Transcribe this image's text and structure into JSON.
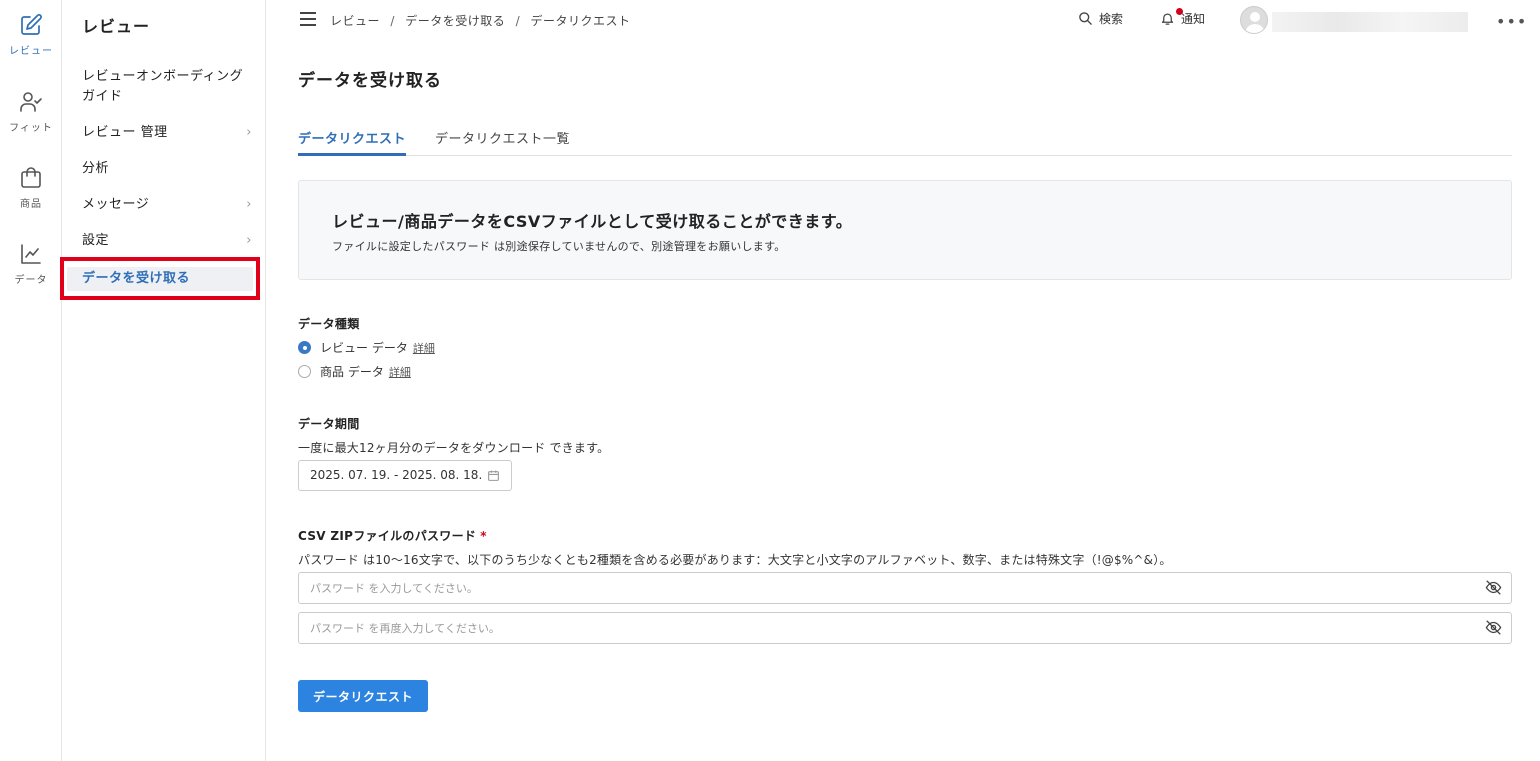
{
  "rail": {
    "items": [
      {
        "label": "レビュー",
        "icon": "edit-icon",
        "active": true
      },
      {
        "label": "フィット",
        "icon": "user-check-icon"
      },
      {
        "label": "商品",
        "icon": "shopping-bag-icon"
      },
      {
        "label": "データ",
        "icon": "line-chart-icon"
      }
    ]
  },
  "subnav": {
    "title": "レビュー",
    "items": [
      {
        "label_line1": "レビューオンボーディング",
        "label_line2": "ガイド"
      },
      {
        "label": "レビュー 管理",
        "chevron": "›"
      },
      {
        "label": "分析"
      },
      {
        "label": "メッセージ",
        "chevron": "›"
      },
      {
        "label": "設定",
        "chevron": "›"
      },
      {
        "label": "データを受け取る",
        "active": true
      }
    ]
  },
  "topbar": {
    "breadcrumb": [
      "レビュー",
      "データを受け取る",
      "データリクエスト"
    ],
    "breadcrumb_sep": "/",
    "search_label": "検索",
    "notification_label": "通知",
    "more": "•••"
  },
  "main": {
    "page_title": "データを受け取る",
    "tabs": [
      {
        "label": "データリクエスト",
        "active": true
      },
      {
        "label": "データリクエスト一覧"
      }
    ],
    "info": {
      "heading": "レビュー/商品データをCSVファイルとして受け取ることができます。",
      "sub": "ファイルに設定したパスワード は別途保存していませんので、別途管理をお願いします。"
    },
    "data_type": {
      "label": "データ種類",
      "options": [
        {
          "label": "レビュー データ",
          "link": "詳細",
          "checked": true
        },
        {
          "label": "商品 データ",
          "link": "詳細",
          "checked": false
        }
      ]
    },
    "period": {
      "label": "データ期間",
      "desc": "一度に最大12ヶ月分のデータをダウンロード できます。",
      "value": "2025. 07. 19. - 2025. 08. 18."
    },
    "password": {
      "label": "CSV ZIPファイルのパスワード",
      "required_mark": "*",
      "desc": "パスワード は10～16文字で、以下のうち少なくとも2種類を含める必要があります：大文字と小文字のアルファベット、数字、または特殊文字（!@$%^&）。",
      "placeholder1": "パスワード を入力してください。",
      "placeholder2": "パスワード を再度入力してください。"
    },
    "submit_label": "データリクエスト"
  },
  "colors": {
    "accent": "#2f6fb8",
    "button": "#2d83e0",
    "highlight": "#e0001a",
    "notification_dot": "#d0021b"
  }
}
